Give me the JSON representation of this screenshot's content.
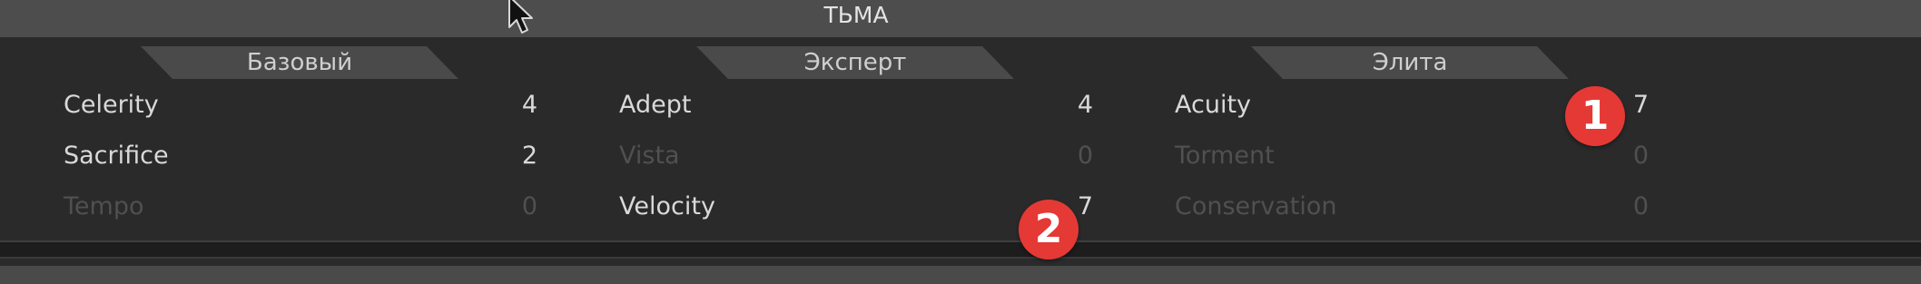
{
  "header": {
    "title": "ТЬМА"
  },
  "tabs": [
    {
      "label": "Базовый"
    },
    {
      "label": "Эксперт"
    },
    {
      "label": "Элита"
    }
  ],
  "columns": [
    {
      "rows": [
        {
          "name": "Celerity",
          "value": "4",
          "active": true
        },
        {
          "name": "Sacrifice",
          "value": "2",
          "active": true
        },
        {
          "name": "Tempo",
          "value": "0",
          "active": false
        }
      ]
    },
    {
      "rows": [
        {
          "name": "Adept",
          "value": "4",
          "active": true
        },
        {
          "name": "Vista",
          "value": "0",
          "active": false
        },
        {
          "name": "Velocity",
          "value": "7",
          "active": true
        }
      ]
    },
    {
      "rows": [
        {
          "name": "Acuity",
          "value": "7",
          "active": true
        },
        {
          "name": "Torment",
          "value": "0",
          "active": false
        },
        {
          "name": "Conservation",
          "value": "0",
          "active": false
        }
      ]
    }
  ],
  "markers": [
    {
      "label": "1"
    },
    {
      "label": "2"
    }
  ],
  "colors": {
    "active_text": "#d9d9d9",
    "inactive_text": "#505050",
    "marker": "#e53935"
  },
  "icons": {
    "cursor": "mouse-pointer-icon"
  }
}
